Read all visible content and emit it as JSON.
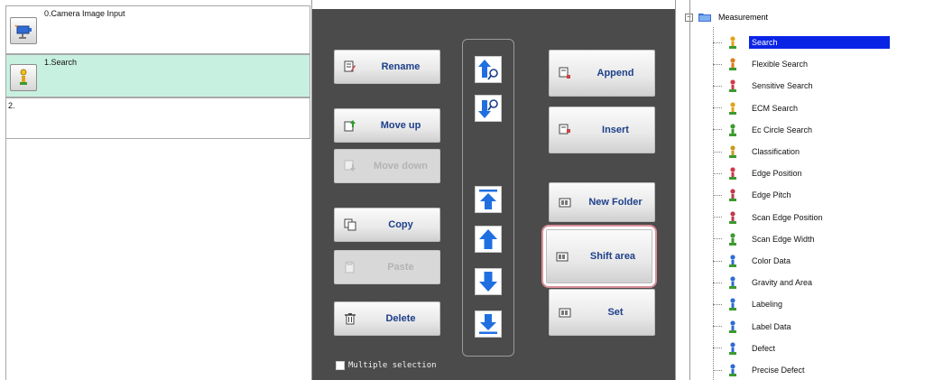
{
  "scene_list": {
    "units": [
      {
        "index": "0",
        "label": "0.Camera Image Input",
        "icon": "camera-icon"
      },
      {
        "index": "1",
        "label": "1.Search",
        "icon": "search-unit-icon",
        "selected": true
      },
      {
        "index": "2",
        "label": "2."
      }
    ]
  },
  "controls": {
    "rename": "Rename",
    "move_up": "Move up",
    "move_down": "Move down",
    "copy": "Copy",
    "paste": "Paste",
    "delete": "Delete",
    "append": "Append",
    "insert": "Insert",
    "new_folder": "New Folder",
    "shift_area": "Shift area",
    "set": "Set",
    "multiple_selection": "Multiple selection",
    "arrows": [
      "search-up-icon",
      "search-down-icon",
      "jump-top-icon",
      "up-icon",
      "down-icon",
      "jump-bottom-icon"
    ]
  },
  "tree": {
    "root": "Measurement",
    "items": [
      {
        "label": "Search",
        "selected": true
      },
      {
        "label": "Flexible Search"
      },
      {
        "label": "Sensitive Search"
      },
      {
        "label": "ECM Search"
      },
      {
        "label": "Ec Circle Search"
      },
      {
        "label": "Classification"
      },
      {
        "label": "Edge Position"
      },
      {
        "label": "Edge Pitch"
      },
      {
        "label": "Scan Edge Position"
      },
      {
        "label": "Scan Edge Width"
      },
      {
        "label": "Color Data"
      },
      {
        "label": "Gravity and Area"
      },
      {
        "label": "Labeling"
      },
      {
        "label": "Label Data"
      },
      {
        "label": "Defect"
      },
      {
        "label": "Precise Defect"
      }
    ]
  },
  "colors": {
    "panel_bg": "#4b4b4b",
    "selected_row": "#c8f0e0",
    "tree_selection": "#0a24e6",
    "button_text": "#1d3f8a",
    "arrow_blue": "#1f6fe0",
    "highlight_ring": "#d98f98"
  }
}
